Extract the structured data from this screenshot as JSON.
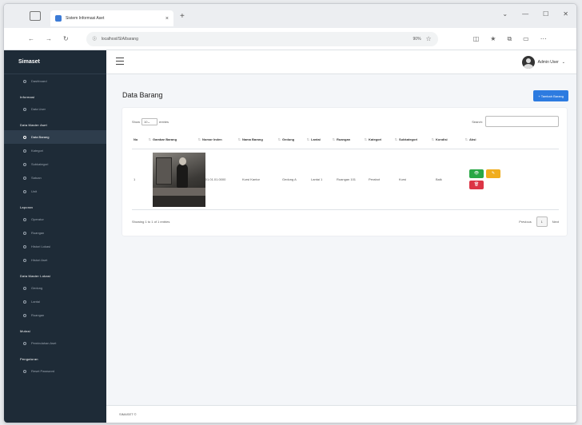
{
  "browser": {
    "tab_title": "Sistem Informasi Aset",
    "url": "localhost/SIA/barang",
    "zoom": "90%"
  },
  "sidebar": {
    "brand": "Simaset",
    "sections": [
      {
        "header": "",
        "items": [
          {
            "label": "Dashboard",
            "active": false
          }
        ]
      },
      {
        "header": "Informasi",
        "items": [
          {
            "label": "Data User",
            "active": false
          }
        ]
      },
      {
        "header": "Data Master Aset",
        "items": [
          {
            "label": "Data Barang",
            "active": true
          },
          {
            "label": "Kategori",
            "active": false
          },
          {
            "label": "Subkategori",
            "active": false
          },
          {
            "label": "Satuan",
            "active": false
          },
          {
            "label": "Unit",
            "active": false
          }
        ]
      },
      {
        "header": "Laporan",
        "items": [
          {
            "label": "Operator",
            "active": false
          },
          {
            "label": "Ruangan",
            "active": false
          },
          {
            "label": "Histori Lokasi",
            "active": false
          },
          {
            "label": "Histori Aset",
            "active": false
          }
        ]
      },
      {
        "header": "Data Master Lokasi",
        "items": [
          {
            "label": "Gedung",
            "active": false
          },
          {
            "label": "Lantai",
            "active": false
          },
          {
            "label": "Ruangan",
            "active": false
          }
        ]
      },
      {
        "header": "Mutasi",
        "items": [
          {
            "label": "Pemindahan Aset",
            "active": false
          }
        ]
      },
      {
        "header": "Pengaturan",
        "items": [
          {
            "label": "Reset Password",
            "active": false
          }
        ]
      }
    ]
  },
  "topnav": {
    "user_name": "Admin User"
  },
  "page": {
    "title": "Data Barang",
    "add_button": "+ Tambah Barang",
    "show_label": "Show",
    "entries_value": "10",
    "entries_label": "entries",
    "search_label": "Search:",
    "search_placeholder": ""
  },
  "table": {
    "columns": [
      "No",
      "Gambar Barang",
      "Nomor Inden",
      "Nama Barang",
      "Gedung",
      "Lantai",
      "Ruangan",
      "Kategori",
      "Subkategori",
      "Kondisi",
      "Aksi"
    ],
    "rows": [
      {
        "no": "1",
        "nomor_inden": "A.01.01.01.0000",
        "nama_barang": "Kursi Kantor",
        "gedung": "Gedung A",
        "lantai": "Lantai 1",
        "ruangan": "Ruangan 101",
        "kategori": "Perabot",
        "subkategori": "Kursi",
        "kondisi": "Baik"
      }
    ],
    "info": "Showing 1 to 1 of 1 entries",
    "prev_label": "Previous",
    "page_number": "1",
    "next_label": "Next"
  },
  "footer": {
    "text": "SIMASET ©"
  },
  "colors": {
    "sidebar_bg": "#1e2b37",
    "primary": "#2d7be0",
    "success": "#28a745",
    "warning": "#f0ad1d",
    "danger": "#dc3545"
  }
}
